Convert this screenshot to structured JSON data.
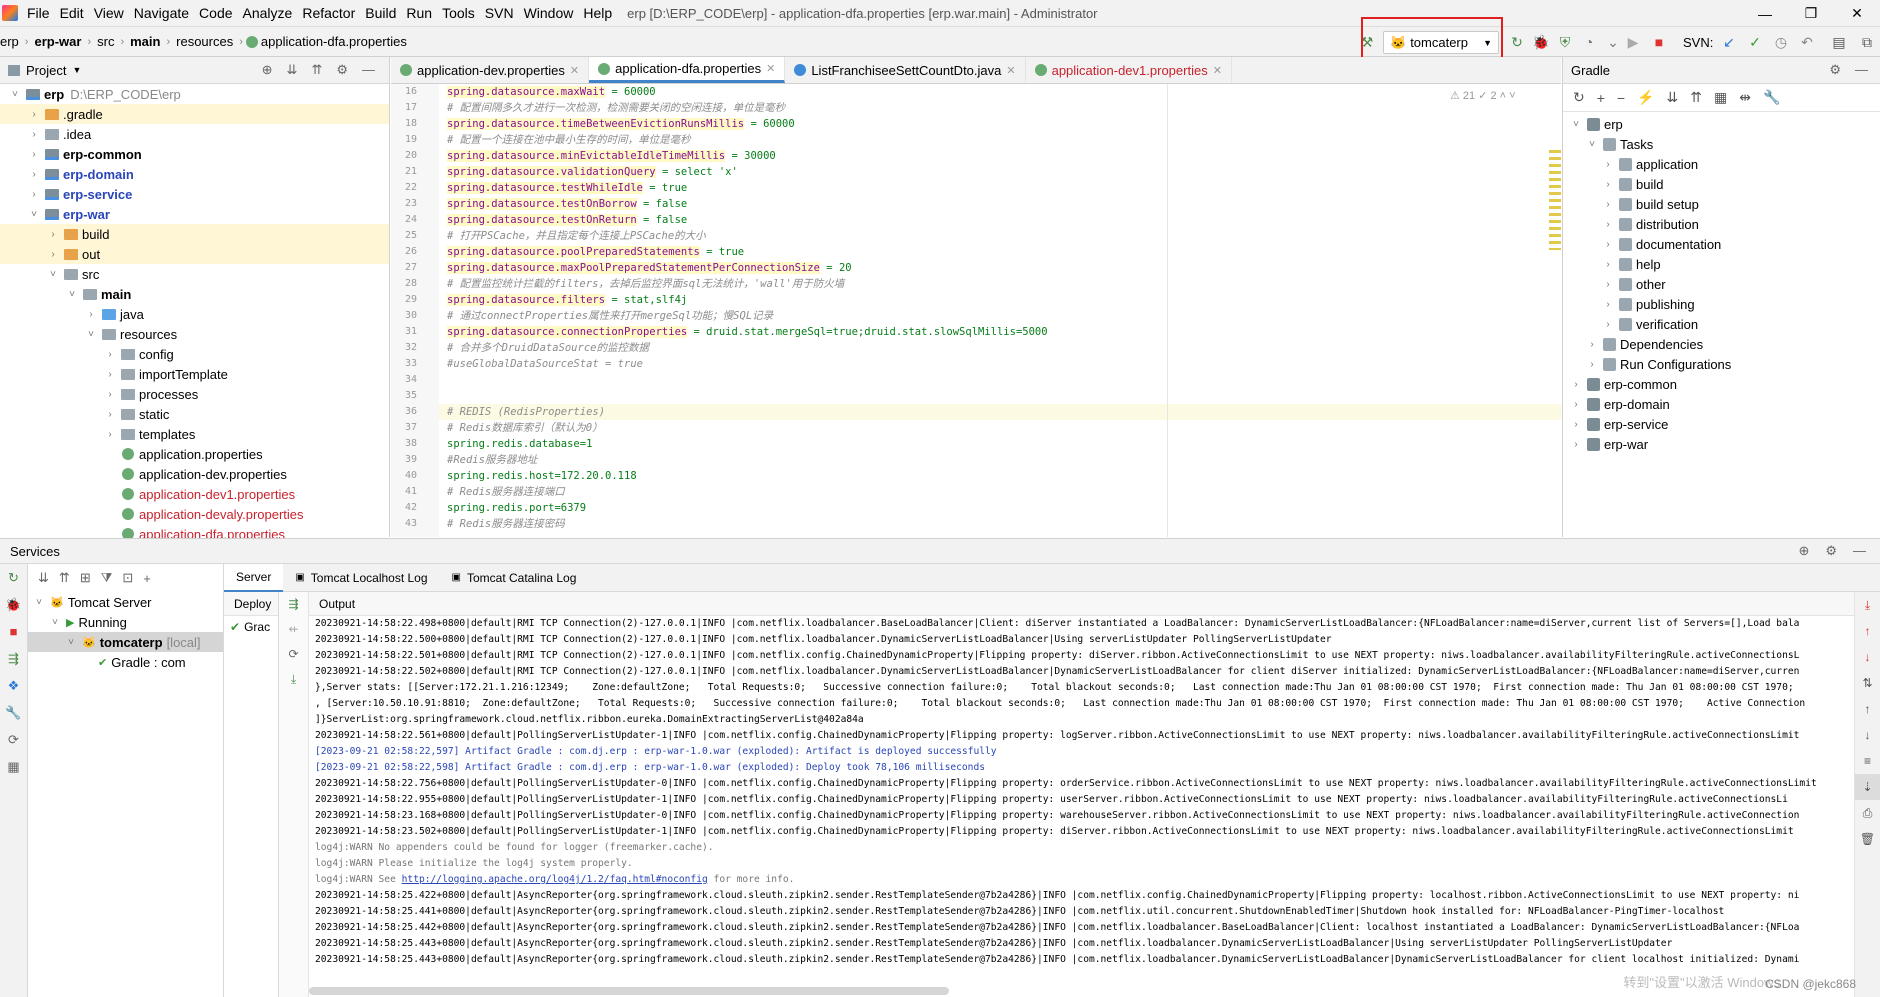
{
  "menubar": {
    "items": [
      "File",
      "Edit",
      "View",
      "Navigate",
      "Code",
      "Analyze",
      "Refactor",
      "Build",
      "Run",
      "Tools",
      "SVN",
      "Window",
      "Help"
    ],
    "title": "erp [D:\\ERP_CODE\\erp] - application-dfa.properties [erp.war.main] - Administrator"
  },
  "breadcrumb": [
    "erp",
    "erp-war",
    "src",
    "main",
    "resources",
    "application-dfa.properties"
  ],
  "run_config": {
    "label": "tomcaterp"
  },
  "svn_label": "SVN:",
  "project": {
    "header": "Project",
    "tree": [
      {
        "label": "erp",
        "path": "D:\\ERP_CODE\\erp",
        "depth": 0,
        "arrow": "˅",
        "icon": "mod",
        "bold": true
      },
      {
        "label": ".gradle",
        "depth": 1,
        "arrow": "›",
        "icon": "orange",
        "excluded": true
      },
      {
        "label": ".idea",
        "depth": 1,
        "arrow": "›",
        "icon": "folder"
      },
      {
        "label": "erp-common",
        "depth": 1,
        "arrow": "›",
        "icon": "mod",
        "bold": true
      },
      {
        "label": "erp-domain",
        "depth": 1,
        "arrow": "›",
        "icon": "mod",
        "bold": true,
        "color": "#2a46b8"
      },
      {
        "label": "erp-service",
        "depth": 1,
        "arrow": "›",
        "icon": "mod",
        "bold": true,
        "color": "#2a46b8"
      },
      {
        "label": "erp-war",
        "depth": 1,
        "arrow": "˅",
        "icon": "mod",
        "bold": true,
        "color": "#2a46b8"
      },
      {
        "label": "build",
        "depth": 2,
        "arrow": "›",
        "icon": "orange",
        "excluded": true
      },
      {
        "label": "out",
        "depth": 2,
        "arrow": "›",
        "icon": "orange",
        "excluded": true
      },
      {
        "label": "src",
        "depth": 2,
        "arrow": "˅",
        "icon": "folder"
      },
      {
        "label": "main",
        "depth": 3,
        "arrow": "˅",
        "icon": "folder",
        "bold": true
      },
      {
        "label": "java",
        "depth": 4,
        "arrow": "›",
        "icon": "blue"
      },
      {
        "label": "resources",
        "depth": 4,
        "arrow": "˅",
        "icon": "folder"
      },
      {
        "label": "config",
        "depth": 5,
        "arrow": "›",
        "icon": "folder"
      },
      {
        "label": "importTemplate",
        "depth": 5,
        "arrow": "›",
        "icon": "folder"
      },
      {
        "label": "processes",
        "depth": 5,
        "arrow": "›",
        "icon": "folder"
      },
      {
        "label": "static",
        "depth": 5,
        "arrow": "›",
        "icon": "folder"
      },
      {
        "label": "templates",
        "depth": 5,
        "arrow": "›",
        "icon": "folder"
      },
      {
        "label": "application.properties",
        "depth": 5,
        "arrow": "",
        "icon": "prop"
      },
      {
        "label": "application-dev.properties",
        "depth": 5,
        "arrow": "",
        "icon": "prop"
      },
      {
        "label": "application-dev1.properties",
        "depth": 5,
        "arrow": "",
        "icon": "prop",
        "color": "#c7222d"
      },
      {
        "label": "application-devaly.properties",
        "depth": 5,
        "arrow": "",
        "icon": "prop",
        "color": "#c7222d"
      },
      {
        "label": "application-dfa.properties",
        "depth": 5,
        "arrow": "",
        "icon": "prop",
        "color": "#c7222d"
      }
    ]
  },
  "editor": {
    "tabs": [
      {
        "label": "application-dev.properties",
        "active": false,
        "color": "#000"
      },
      {
        "label": "application-dfa.properties",
        "active": true,
        "color": "#000"
      },
      {
        "label": "ListFranchiseeSettCountDto.java",
        "active": false,
        "color": "#000"
      },
      {
        "label": "application-dev1.properties",
        "active": false,
        "color": "#c7222d"
      }
    ],
    "inspections": "⚠ 21  ✓ 2  ˄  ˅",
    "lines": [
      {
        "n": "16",
        "k": "spring.datasource.maxWait",
        " v": "",
        "v": " = 60000",
        "t": "kv"
      },
      {
        "n": "17",
        "v": "# 配置间隔多久才进行一次检测，检测需要关闭的空闲连接，单位是毫秒",
        "t": "c"
      },
      {
        "n": "18",
        "k": "spring.datasource.timeBetweenEvictionRunsMillis",
        "v": " = 60000",
        "t": "kv"
      },
      {
        "n": "19",
        "v": "# 配置一个连接在池中最小生存的时间，单位是毫秒",
        "t": "c"
      },
      {
        "n": "20",
        "k": "spring.datasource.minEvictableIdleTimeMillis",
        "v": " = 30000",
        "t": "kv"
      },
      {
        "n": "21",
        "k": "spring.datasource.validationQuery",
        "v": " = select 'x'",
        "t": "kv"
      },
      {
        "n": "22",
        "k": "spring.datasource.testWhileIdle",
        "v": " = true",
        "t": "kv"
      },
      {
        "n": "23",
        "k": "spring.datasource.testOnBorrow",
        "v": " = false",
        "t": "kv"
      },
      {
        "n": "24",
        "k": "spring.datasource.testOnReturn",
        "v": " = false",
        "t": "kv"
      },
      {
        "n": "25",
        "v": "# 打开PSCache，并且指定每个连接上PSCache的大小",
        "t": "c"
      },
      {
        "n": "26",
        "k": "spring.datasource.poolPreparedStatements",
        "v": " = true",
        "t": "kv"
      },
      {
        "n": "27",
        "k": "spring.datasource.maxPoolPreparedStatementPerConnectionSize",
        "v": " = 20",
        "t": "kv"
      },
      {
        "n": "28",
        "v": "# 配置监控统计拦截的filters，去掉后监控界面sql无法统计，'wall'用于防火墙",
        "t": "c"
      },
      {
        "n": "29",
        "k": "spring.datasource.filters",
        "v": " = stat,slf4j",
        "t": "kv"
      },
      {
        "n": "30",
        "v": "# 通过connectProperties属性来打开mergeSql功能；慢SQL记录",
        "t": "c"
      },
      {
        "n": "31",
        "k": "spring.datasource.connectionProperties",
        "v": " = druid.stat.mergeSql=true;druid.stat.slowSqlMillis=5000",
        "t": "kv"
      },
      {
        "n": "32",
        "v": "# 合并多个DruidDataSource的监控数据",
        "t": "c"
      },
      {
        "n": "33",
        "v": "#useGlobalDataSourceStat = true",
        "t": "c"
      },
      {
        "n": "34",
        "v": "",
        "t": "e"
      },
      {
        "n": "35",
        "v": "",
        "t": "e"
      },
      {
        "n": "36",
        "v": "# REDIS (RedisProperties)",
        "t": "c",
        "hl": true
      },
      {
        "n": "37",
        "v": "# Redis数据库索引（默认为0）",
        "t": "c"
      },
      {
        "n": "38",
        "k": "",
        "v": "spring.redis.database=1",
        "t": "v"
      },
      {
        "n": "39",
        "v": "#Redis服务器地址",
        "t": "c"
      },
      {
        "n": "40",
        "v": "spring.redis.host=172.20.0.118",
        "t": "v"
      },
      {
        "n": "41",
        "v": "# Redis服务器连接端口",
        "t": "c"
      },
      {
        "n": "42",
        "v": "spring.redis.port=6379",
        "t": "v"
      },
      {
        "n": "43",
        "v": "# Redis服务器连接密码",
        "t": "c"
      }
    ]
  },
  "gradle": {
    "header": "Gradle",
    "tree": [
      {
        "label": "erp",
        "depth": 0,
        "arrow": "˅",
        "icon": "el"
      },
      {
        "label": "Tasks",
        "depth": 1,
        "arrow": "˅",
        "icon": "folder"
      },
      {
        "label": "application",
        "depth": 2,
        "arrow": "›",
        "icon": "folder"
      },
      {
        "label": "build",
        "depth": 2,
        "arrow": "›",
        "icon": "folder"
      },
      {
        "label": "build setup",
        "depth": 2,
        "arrow": "›",
        "icon": "folder"
      },
      {
        "label": "distribution",
        "depth": 2,
        "arrow": "›",
        "icon": "folder"
      },
      {
        "label": "documentation",
        "depth": 2,
        "arrow": "›",
        "icon": "folder"
      },
      {
        "label": "help",
        "depth": 2,
        "arrow": "›",
        "icon": "folder"
      },
      {
        "label": "other",
        "depth": 2,
        "arrow": "›",
        "icon": "folder"
      },
      {
        "label": "publishing",
        "depth": 2,
        "arrow": "›",
        "icon": "folder"
      },
      {
        "label": "verification",
        "depth": 2,
        "arrow": "›",
        "icon": "folder"
      },
      {
        "label": "Dependencies",
        "depth": 1,
        "arrow": "›",
        "icon": "folder"
      },
      {
        "label": "Run Configurations",
        "depth": 1,
        "arrow": "›",
        "icon": "folder"
      },
      {
        "label": "erp-common",
        "depth": 0,
        "arrow": "›",
        "icon": "el"
      },
      {
        "label": "erp-domain",
        "depth": 0,
        "arrow": "›",
        "icon": "el"
      },
      {
        "label": "erp-service",
        "depth": 0,
        "arrow": "›",
        "icon": "el"
      },
      {
        "label": "erp-war",
        "depth": 0,
        "arrow": "›",
        "icon": "el"
      }
    ]
  },
  "services": {
    "header": "Services",
    "tree": [
      {
        "label": "Tomcat Server",
        "depth": 0,
        "arrow": "˅",
        "bold": false
      },
      {
        "label": "Running",
        "depth": 1,
        "arrow": "˅",
        "bold": false
      },
      {
        "label": "tomcaterp",
        "suffix": "[local]",
        "depth": 2,
        "arrow": "˅",
        "bold": true,
        "selected": true
      },
      {
        "label": "Gradle : com",
        "depth": 3,
        "arrow": "",
        "bold": false
      }
    ],
    "tabs": [
      "Server",
      "Tomcat Localhost Log",
      "Tomcat Catalina Log"
    ],
    "deploy_header": "Deploy",
    "deploy_item": "Grac",
    "output_header": "Output",
    "log": [
      {
        "t": "20230921-14:58:22.498+0800|default|RMI TCP Connection(2)-127.0.0.1|INFO |com.netflix.loadbalancer.BaseLoadBalancer|Client: diServer instantiated a LoadBalancer: DynamicServerListLoadBalancer:{NFLoadBalancer:name=diServer,current list of Servers=[],Load bala",
        "c": ""
      },
      {
        "t": "20230921-14:58:22.500+0800|default|RMI TCP Connection(2)-127.0.0.1|INFO |com.netflix.loadbalancer.DynamicServerListLoadBalancer|Using serverListUpdater PollingServerListUpdater",
        "c": ""
      },
      {
        "t": "20230921-14:58:22.501+0800|default|RMI TCP Connection(2)-127.0.0.1|INFO |com.netflix.config.ChainedDynamicProperty|Flipping property: diServer.ribbon.ActiveConnectionsLimit to use NEXT property: niws.loadbalancer.availabilityFilteringRule.activeConnectionsL",
        "c": ""
      },
      {
        "t": "20230921-14:58:22.502+0800|default|RMI TCP Connection(2)-127.0.0.1|INFO |com.netflix.loadbalancer.DynamicServerListLoadBalancer|DynamicServerListLoadBalancer for client diServer initialized: DynamicServerListLoadBalancer:{NFLoadBalancer:name=diServer,curren",
        "c": ""
      },
      {
        "t": "},Server stats: [[Server:172.21.1.216:12349;    Zone:defaultZone;   Total Requests:0;   Successive connection failure:0;    Total blackout seconds:0;   Last connection made:Thu Jan 01 08:00:00 CST 1970;  First connection made: Thu Jan 01 08:00:00 CST 1970;",
        "c": ""
      },
      {
        "t": ", [Server:10.50.10.91:8810;  Zone:defaultZone;   Total Requests:0;   Successive connection failure:0;    Total blackout seconds:0;   Last connection made:Thu Jan 01 08:00:00 CST 1970;  First connection made: Thu Jan 01 08:00:00 CST 1970;    Active Connection",
        "c": ""
      },
      {
        "t": "]}ServerList:org.springframework.cloud.netflix.ribbon.eureka.DomainExtractingServerList@402a84a",
        "c": ""
      },
      {
        "t": "20230921-14:58:22.561+0800|default|PollingServerListUpdater-1|INFO |com.netflix.config.ChainedDynamicProperty|Flipping property: logServer.ribbon.ActiveConnectionsLimit to use NEXT property: niws.loadbalancer.availabilityFilteringRule.activeConnectionsLimit",
        "c": ""
      },
      {
        "t": "[2023-09-21 02:58:22,597] Artifact Gradle : com.dj.erp : erp-war-1.0.war (exploded): Artifact is deployed successfully",
        "c": "blue"
      },
      {
        "t": "[2023-09-21 02:58:22,598] Artifact Gradle : com.dj.erp : erp-war-1.0.war (exploded): Deploy took 78,106 milliseconds",
        "c": "blue"
      },
      {
        "t": "20230921-14:58:22.756+0800|default|PollingServerListUpdater-0|INFO |com.netflix.config.ChainedDynamicProperty|Flipping property: orderService.ribbon.ActiveConnectionsLimit to use NEXT property: niws.loadbalancer.availabilityFilteringRule.activeConnectionsLimit",
        "c": ""
      },
      {
        "t": "20230921-14:58:22.955+0800|default|PollingServerListUpdater-1|INFO |com.netflix.config.ChainedDynamicProperty|Flipping property: userServer.ribbon.ActiveConnectionsLimit to use NEXT property: niws.loadbalancer.availabilityFilteringRule.activeConnectionsLi",
        "c": ""
      },
      {
        "t": "20230921-14:58:23.168+0800|default|PollingServerListUpdater-0|INFO |com.netflix.config.ChainedDynamicProperty|Flipping property: warehouseServer.ribbon.ActiveConnectionsLimit to use NEXT property: niws.loadbalancer.availabilityFilteringRule.activeConnection",
        "c": ""
      },
      {
        "t": "20230921-14:58:23.502+0800|default|PollingServerListUpdater-1|INFO |com.netflix.config.ChainedDynamicProperty|Flipping property: diServer.ribbon.ActiveConnectionsLimit to use NEXT property: niws.loadbalancer.availabilityFilteringRule.activeConnectionsLimit",
        "c": ""
      },
      {
        "t": "log4j:WARN No appenders could be found for logger (freemarker.cache).",
        "c": "grey"
      },
      {
        "t": "log4j:WARN Please initialize the log4j system properly.",
        "c": "grey"
      },
      {
        "t": "log4j:WARN See ",
        "link": "http://logging.apache.org/log4j/1.2/faq.html#noconfig",
        "after": " for more info.",
        "c": "grey"
      },
      {
        "t": "20230921-14:58:25.422+0800|default|AsyncReporter{org.springframework.cloud.sleuth.zipkin2.sender.RestTemplateSender@7b2a4286}|INFO |com.netflix.config.ChainedDynamicProperty|Flipping property: localhost.ribbon.ActiveConnectionsLimit to use NEXT property: ni",
        "c": ""
      },
      {
        "t": "20230921-14:58:25.441+0800|default|AsyncReporter{org.springframework.cloud.sleuth.zipkin2.sender.RestTemplateSender@7b2a4286}|INFO |com.netflix.util.concurrent.ShutdownEnabledTimer|Shutdown hook installed for: NFLoadBalancer-PingTimer-localhost",
        "c": ""
      },
      {
        "t": "20230921-14:58:25.442+0800|default|AsyncReporter{org.springframework.cloud.sleuth.zipkin2.sender.RestTemplateSender@7b2a4286}|INFO |com.netflix.loadbalancer.BaseLoadBalancer|Client: localhost instantiated a LoadBalancer: DynamicServerListLoadBalancer:{NFLoa",
        "c": ""
      },
      {
        "t": "20230921-14:58:25.443+0800|default|AsyncReporter{org.springframework.cloud.sleuth.zipkin2.sender.RestTemplateSender@7b2a4286}|INFO |com.netflix.loadbalancer.DynamicServerListLoadBalancer|Using serverListUpdater PollingServerListUpdater",
        "c": ""
      },
      {
        "t": "20230921-14:58:25.443+0800|default|AsyncReporter{org.springframework.cloud.sleuth.zipkin2.sender.RestTemplateSender@7b2a4286}|INFO |com.netflix.loadbalancer.DynamicServerListLoadBalancer|DynamicServerListLoadBalancer for client localhost initialized: Dynami",
        "c": ""
      }
    ]
  },
  "watermark": "转到\"设置\"以激活 Windows",
  "csdn": "CSDN @jekc868",
  "colors": {
    "accent": "#4083c9",
    "redbox": "#e02020",
    "key_bg": "#fff9c4"
  }
}
